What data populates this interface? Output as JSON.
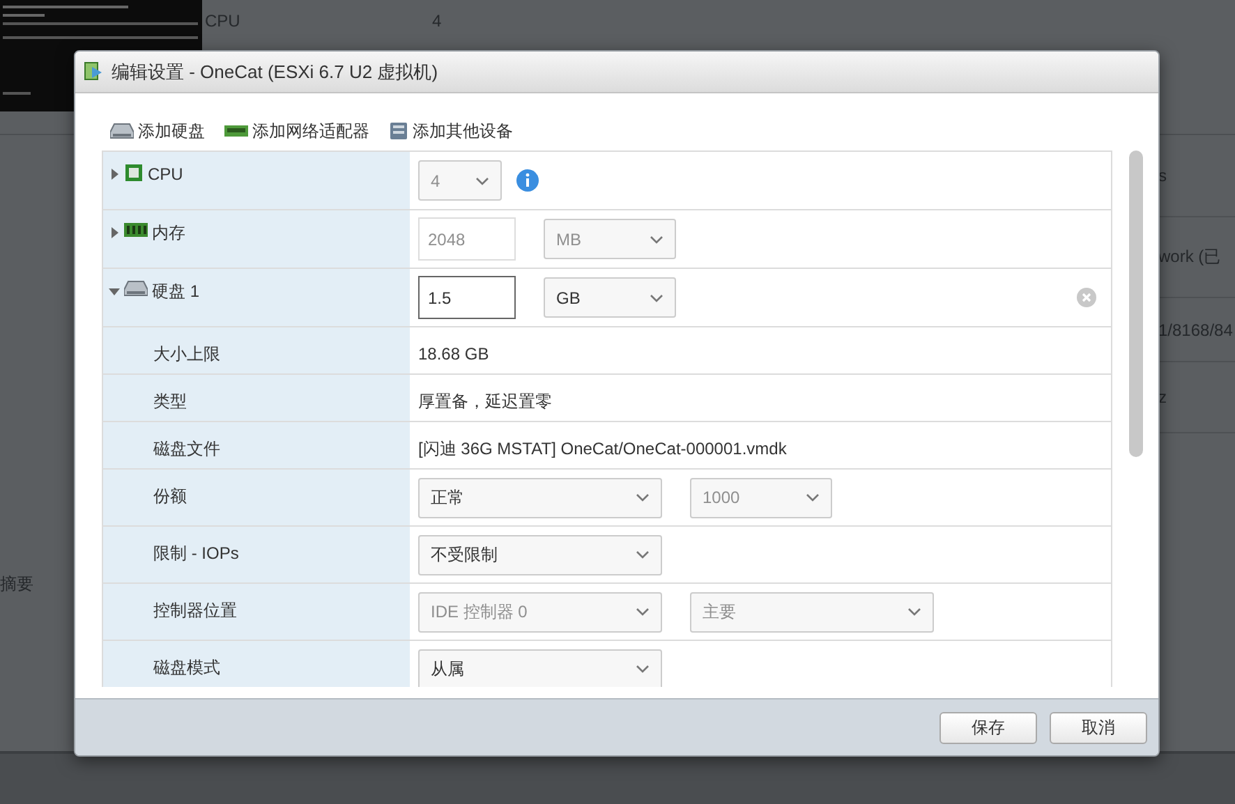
{
  "background": {
    "console": {
      "kind": "picture"
    },
    "info": [
      {
        "label": "CPU",
        "value": "4"
      }
    ],
    "left_items": [
      "摘要"
    ],
    "right_items": [
      "s",
      "work (已",
      "1/8168/84",
      "z"
    ]
  },
  "dialog": {
    "title": "编辑设置 - OneCat (ESXi 6.7 U2 虚拟机)",
    "toolbar": [
      {
        "label": "添加硬盘"
      },
      {
        "label": "添加网络适配器"
      },
      {
        "label": "添加其他设备"
      }
    ],
    "rows": [
      {
        "kind": "group",
        "label": "CPU",
        "expanded": false,
        "removable": false,
        "controls": [
          {
            "kind": "number-select",
            "value": "4",
            "disabled": true
          },
          {
            "kind": "info"
          }
        ]
      },
      {
        "kind": "group",
        "label": "内存",
        "expanded": false,
        "removable": false,
        "controls": [
          {
            "kind": "input",
            "value": "2048",
            "disabled": true
          },
          {
            "kind": "unit-select",
            "value": "MB",
            "disabled": true
          }
        ]
      },
      {
        "kind": "group",
        "label": "硬盘 1",
        "expanded": true,
        "removable": true,
        "controls": [
          {
            "kind": "input",
            "value": "1.5",
            "disabled": false
          },
          {
            "kind": "unit-select",
            "value": "GB",
            "disabled": false
          }
        ]
      },
      {
        "kind": "sub",
        "label": "大小上限",
        "controls": [
          {
            "kind": "text",
            "value": "18.68 GB"
          }
        ]
      },
      {
        "kind": "sub",
        "label": "类型",
        "controls": [
          {
            "kind": "text",
            "value": "厚置备，延迟置零"
          }
        ]
      },
      {
        "kind": "sub",
        "label": "磁盘文件",
        "controls": [
          {
            "kind": "text",
            "value": "[闪迪 36G MSTAT] OneCat/OneCat-000001.vmdk"
          }
        ]
      },
      {
        "kind": "sub",
        "label": "份额",
        "controls": [
          {
            "kind": "select",
            "value": "正常",
            "disabled": false
          },
          {
            "kind": "short-select",
            "value": "1000",
            "disabled": true
          }
        ]
      },
      {
        "kind": "sub",
        "label": "限制 - IOPs",
        "controls": [
          {
            "kind": "select",
            "value": "不受限制",
            "disabled": false
          }
        ]
      },
      {
        "kind": "sub",
        "label": "控制器位置",
        "controls": [
          {
            "kind": "select",
            "value": "IDE 控制器 0",
            "disabled": true
          },
          {
            "kind": "select",
            "value": "主要",
            "disabled": true
          }
        ]
      },
      {
        "kind": "sub",
        "label": "磁盘模式",
        "controls": [
          {
            "kind": "select",
            "value": "从属",
            "disabled": false
          }
        ]
      }
    ],
    "buttons": [
      {
        "label": "保存"
      },
      {
        "label": "取消"
      }
    ]
  }
}
